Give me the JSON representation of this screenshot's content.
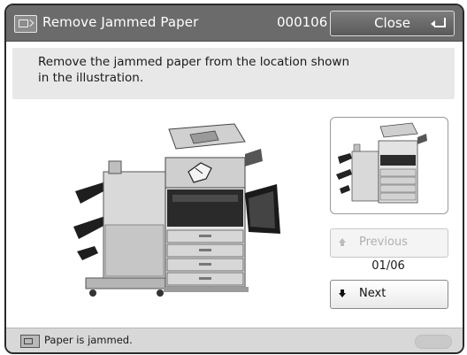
{
  "titlebar": {
    "title": "Remove Jammed Paper",
    "code": "000106",
    "close_label": "Close"
  },
  "instruction": {
    "text": "Remove the jammed paper from the location shown in the illustration."
  },
  "navigation": {
    "previous_label": "Previous",
    "page_indicator": "01/06",
    "next_label": "Next"
  },
  "status": {
    "text": "Paper is jammed."
  },
  "icons": {
    "title": "jam-screen-icon",
    "close": "enter-return-icon",
    "previous": "arrow-up-icon",
    "next": "arrow-down-icon",
    "status": "printer-jam-icon",
    "jam_marker": "hand-pointer-icon"
  }
}
